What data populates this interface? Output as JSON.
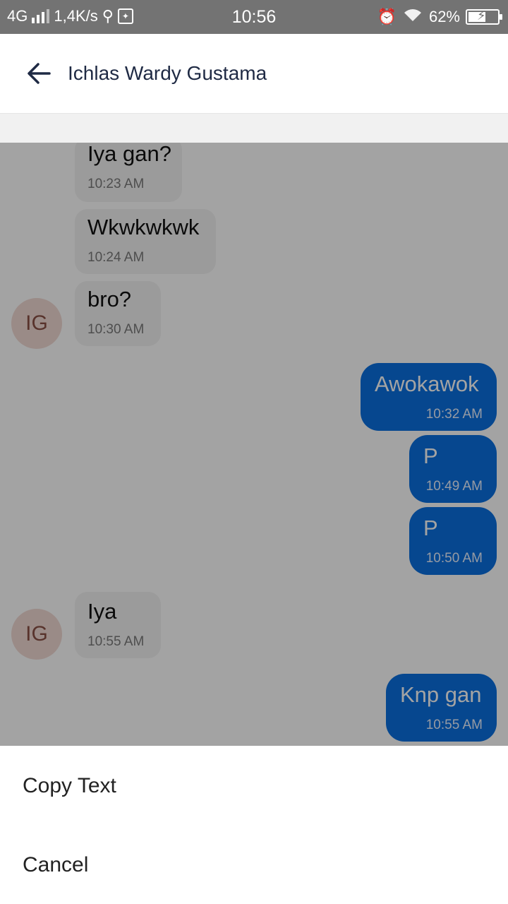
{
  "status_bar": {
    "network": "4G",
    "speed": "1,4K/s",
    "time": "10:56",
    "battery": "62%",
    "icons": [
      "signal-icon",
      "usb-icon",
      "debug-icon",
      "alarm-icon",
      "wifi-icon",
      "battery-icon"
    ]
  },
  "header": {
    "back_icon": "arrow-left-icon",
    "title": "Ichlas Wardy Gustama"
  },
  "messages": [
    {
      "dir": "in",
      "text": "Iya gan?",
      "time": "10:23 AM"
    },
    {
      "dir": "in",
      "text": "Wkwkwkwk",
      "time": "10:24 AM"
    },
    {
      "dir": "in",
      "text": "bro?",
      "time": "10:30 AM",
      "avatar": "IG"
    },
    {
      "dir": "out",
      "text": "Awokawok",
      "time": "10:32 AM"
    },
    {
      "dir": "out",
      "text": "P",
      "time": "10:49 AM"
    },
    {
      "dir": "out",
      "text": "P",
      "time": "10:50 AM"
    },
    {
      "dir": "in",
      "text": "Iya",
      "time": "10:55 AM",
      "avatar": "IG"
    },
    {
      "dir": "out",
      "text": "Knp gan",
      "time": "10:55 AM"
    }
  ],
  "sheet": {
    "copy_text": "Copy Text",
    "cancel": "Cancel"
  },
  "colors": {
    "outgoing_bubble": "#0a6fe0",
    "status_bar": "#737373",
    "avatar_bg": "#f1d9d3"
  }
}
